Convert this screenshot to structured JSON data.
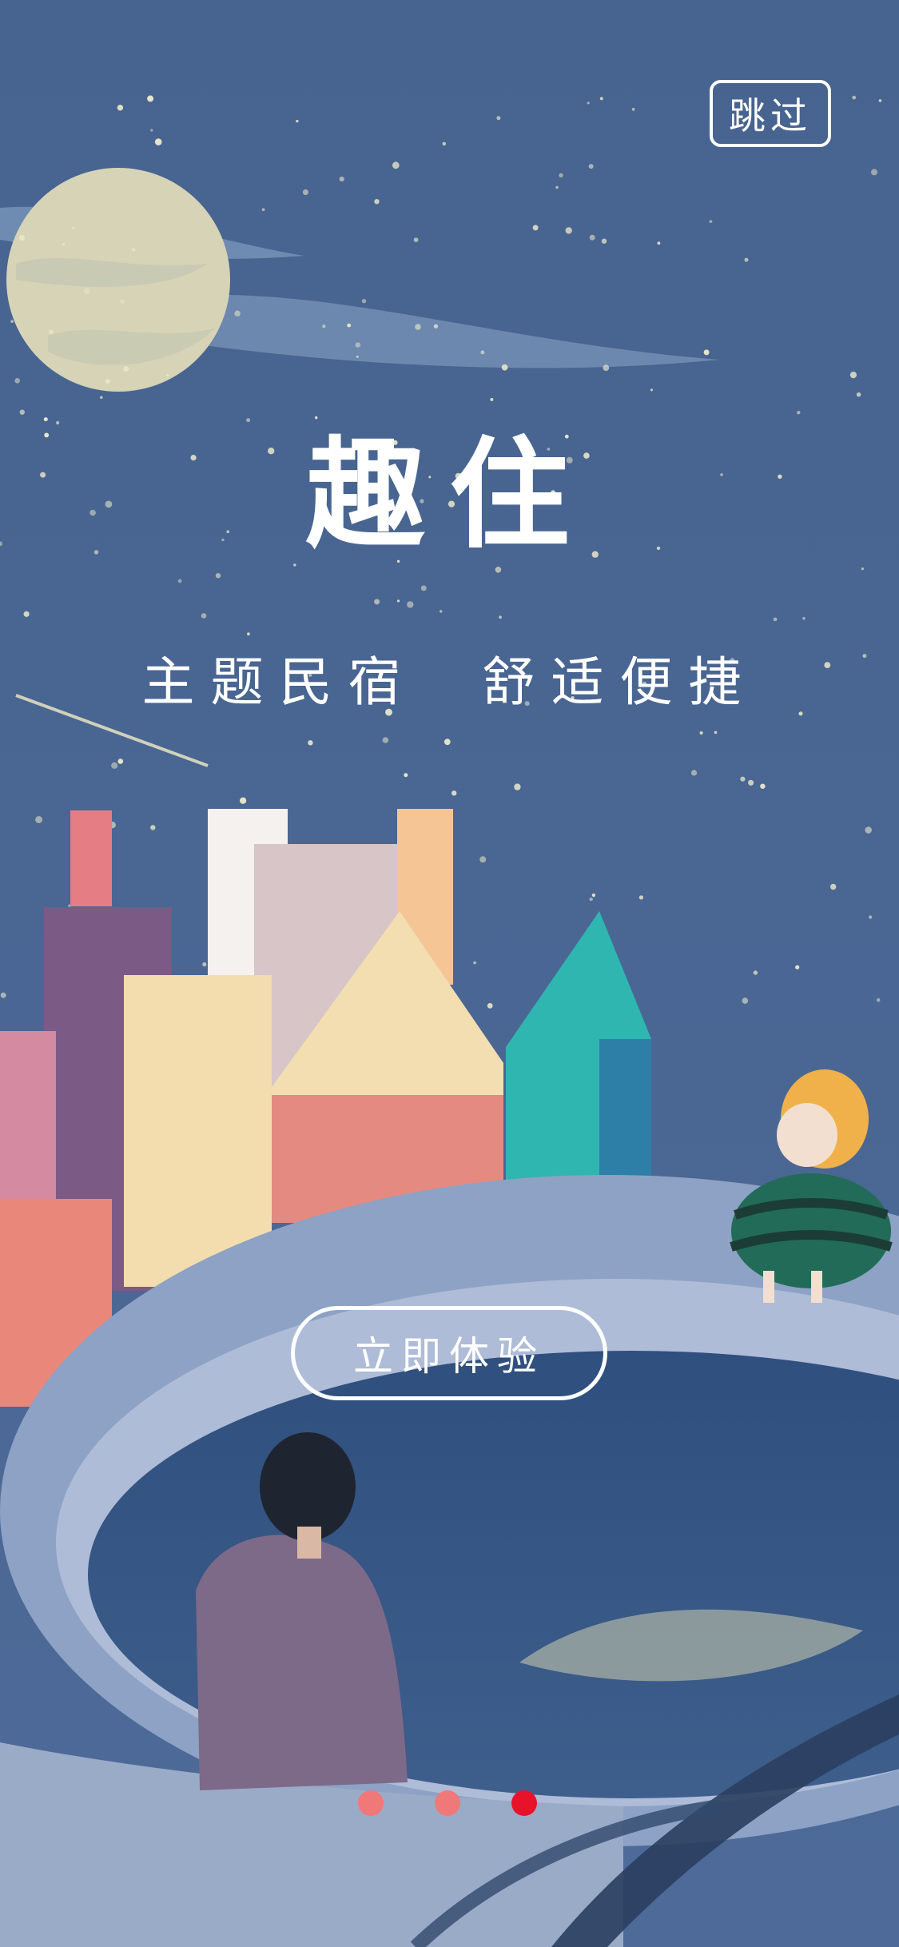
{
  "header": {
    "skip_label": "跳过"
  },
  "hero": {
    "title": "趣住",
    "tagline": "主题民宿  舒适便捷"
  },
  "cta": {
    "label": "立即体验"
  },
  "pagination": {
    "total": 3,
    "active_index": 2,
    "colors": {
      "inactive": "#f07878",
      "active": "#e8132a"
    }
  },
  "icons": [
    "moon-illustration",
    "city-skyline-illustration",
    "pear-doll-illustration",
    "person-illustration"
  ]
}
